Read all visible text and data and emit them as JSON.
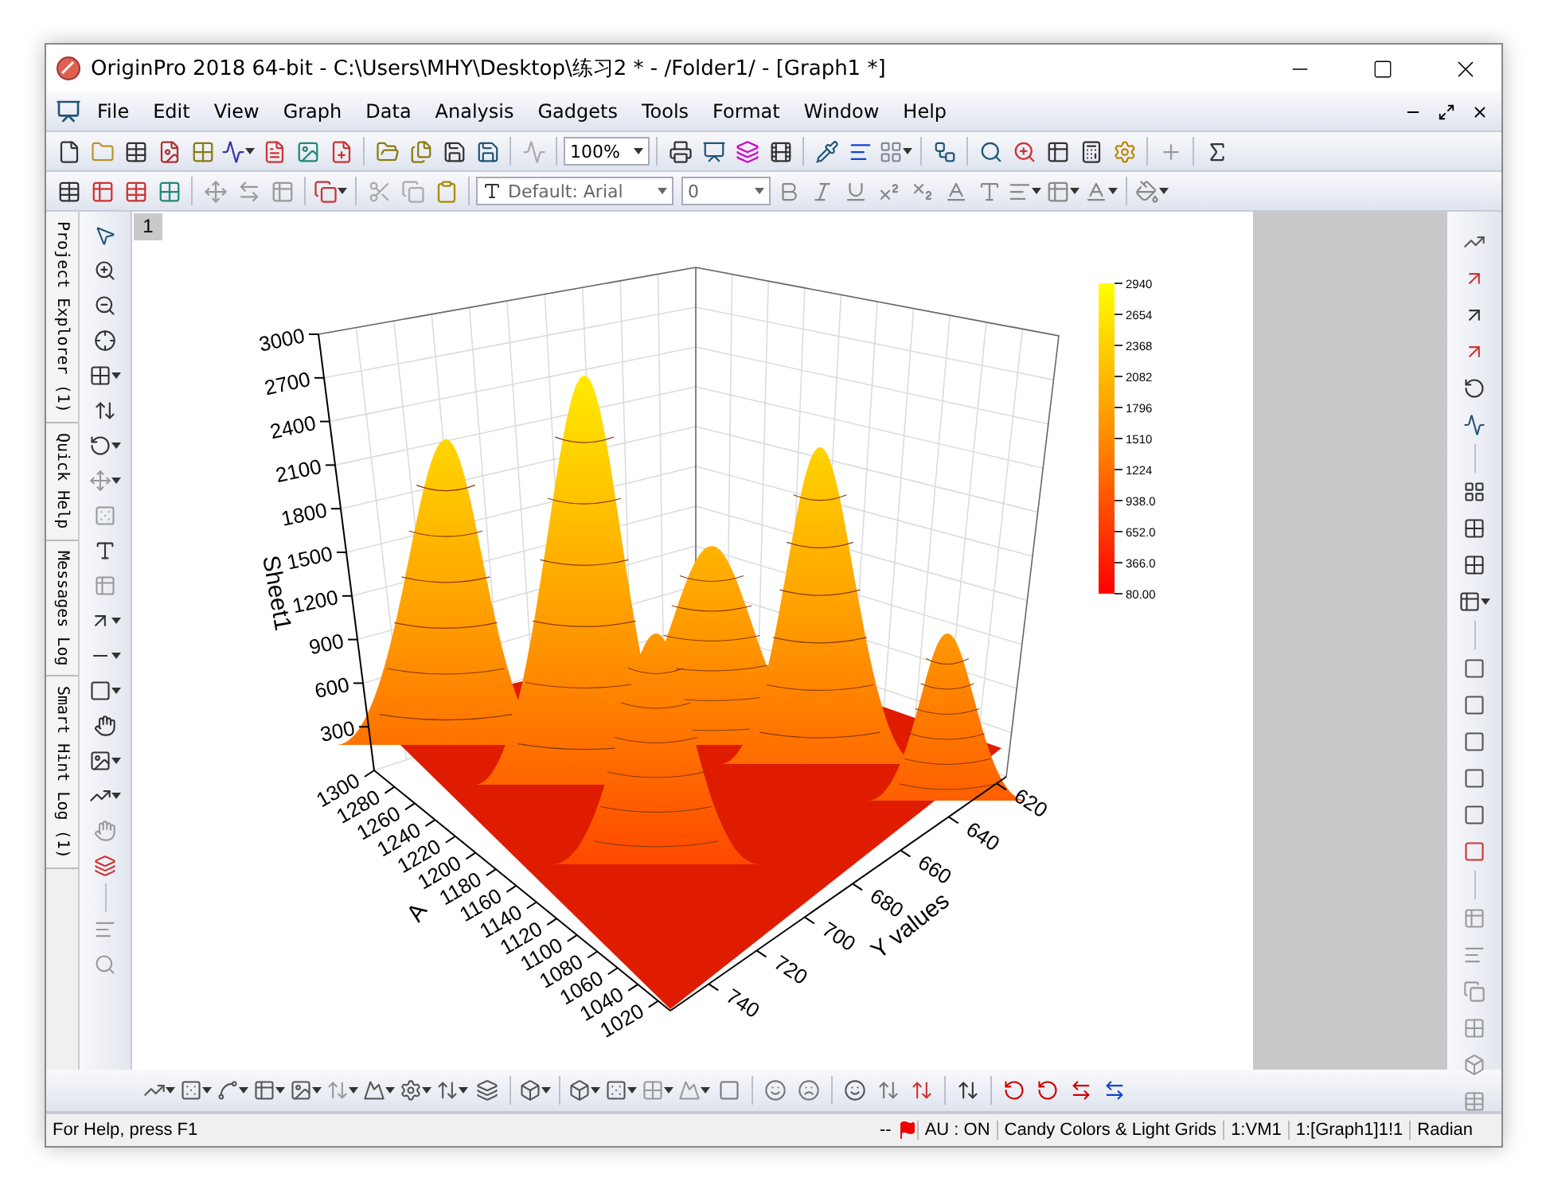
{
  "window": {
    "title": "OriginPro 2018 64-bit - C:\\Users\\MHY\\Desktop\\练习2 * - /Folder1/ - [Graph1 *]"
  },
  "menu": [
    "File",
    "Edit",
    "View",
    "Graph",
    "Data",
    "Analysis",
    "Gadgets",
    "Tools",
    "Format",
    "Window",
    "Help"
  ],
  "toolbar": {
    "zoom": "100%",
    "font": "Default: Arial",
    "font_size": "0"
  },
  "side_tabs": [
    "Project Explorer (1)",
    "Quick Help",
    "Messages Log",
    "Smart Hint Log (1)"
  ],
  "graph": {
    "layer": "1",
    "z_label": "Sheet1",
    "x_label": "A",
    "y_label": "Y values",
    "z_ticks": [
      "3000",
      "2700",
      "2400",
      "2100",
      "1800",
      "1500",
      "1200",
      "900",
      "600",
      "300"
    ],
    "x_ticks": [
      "1300",
      "1280",
      "1260",
      "1240",
      "1220",
      "1200",
      "1180",
      "1160",
      "1140",
      "1120",
      "1100",
      "1080",
      "1060",
      "1040",
      "1020"
    ],
    "y_ticks": [
      "620",
      "640",
      "660",
      "680",
      "700",
      "720",
      "740"
    ],
    "colorbar": [
      "2940",
      "2654",
      "2368",
      "2082",
      "1796",
      "1510",
      "1224",
      "938.0",
      "652.0",
      "366.0",
      "80.00"
    ]
  },
  "status_bar": {
    "help": "For Help, press F1",
    "panes": [
      "--",
      "AU : ON",
      "Candy Colors & Light Grids",
      "1:VM1",
      "1:[Graph1]1!1",
      "Radian"
    ]
  }
}
